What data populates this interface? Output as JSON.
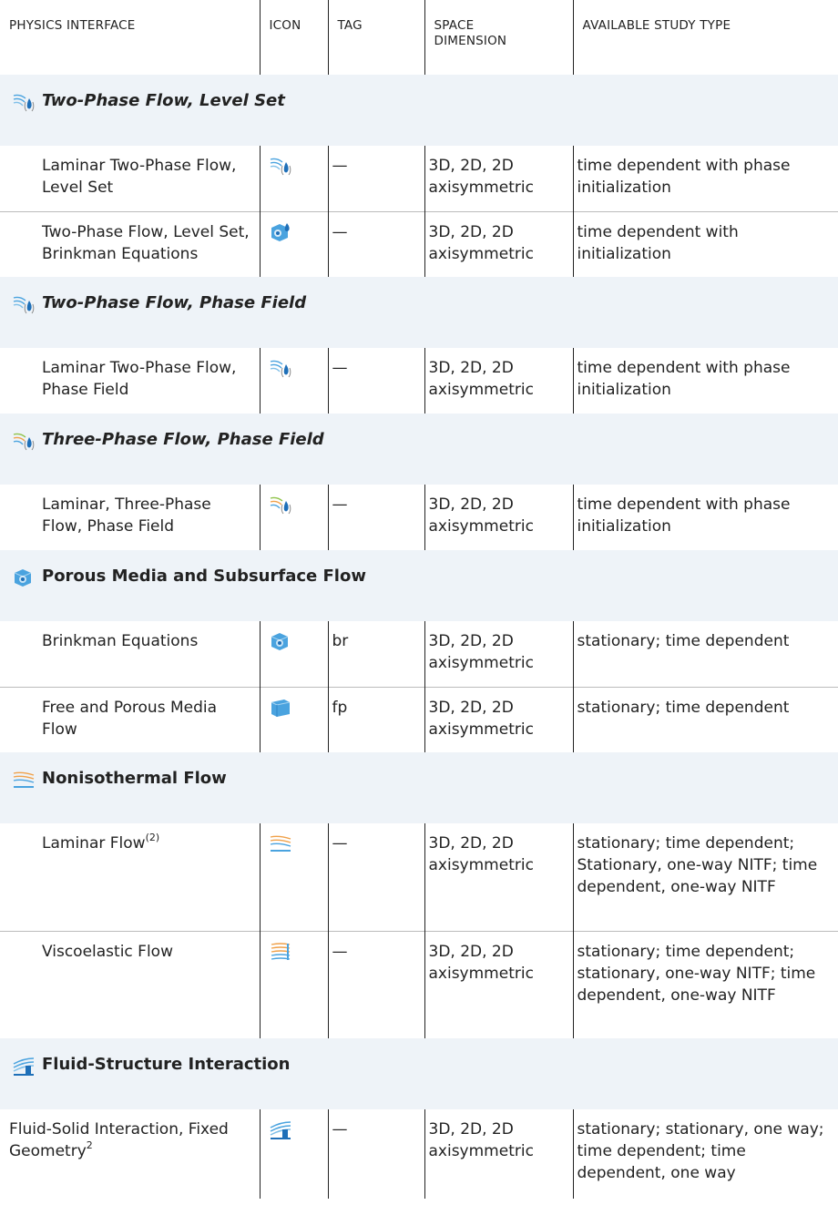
{
  "headers": {
    "physics_interface": "PHYSICS INTERFACE",
    "icon": "ICON",
    "tag": "TAG",
    "space_dimension_1": "SPACE",
    "space_dimension_2": "DIMENSION",
    "available_study_type": "AVAILABLE STUDY TYPE"
  },
  "colors": {
    "section_bg": "#eef3f8",
    "icon_blue": "#4aa3df",
    "icon_green": "#8fc34a",
    "icon_orange": "#f0a14a"
  },
  "sections": {
    "s1": {
      "title": "Two-Phase Flow, Level Set",
      "icon": "two-phase-flow-icon"
    },
    "s2": {
      "title": "Two-Phase Flow, Phase Field",
      "icon": "two-phase-flow-icon"
    },
    "s3": {
      "title": "Three-Phase Flow, Phase Field",
      "icon": "three-phase-flow-icon"
    },
    "s4": {
      "title": "Porous Media and Subsurface Flow",
      "icon": "porous-media-icon"
    },
    "s5": {
      "title": "Nonisothermal Flow",
      "icon": "nonisothermal-flow-icon"
    },
    "s6": {
      "title": "Fluid-Structure Interaction",
      "icon": "fluid-structure-icon"
    }
  },
  "rows": {
    "r1": {
      "name": "Laminar Two-Phase Flow, Level Set",
      "tag": "—",
      "space": "3D, 2D, 2D axisymmetric",
      "study": "time dependent with phase initialization",
      "icon": "two-phase-flow-icon"
    },
    "r2": {
      "name": "Two-Phase Flow, Level Set, Brinkman Equations",
      "tag": "—",
      "space": "3D, 2D, 2D axisymmetric",
      "study": "time dependent with initialization",
      "icon": "brinkman-two-phase-icon"
    },
    "r3": {
      "name": "Laminar Two-Phase Flow, Phase Field",
      "tag": "—",
      "space": "3D, 2D, 2D axisymmetric",
      "study": "time dependent with phase initialization",
      "icon": "two-phase-flow-icon"
    },
    "r4": {
      "name": "Laminar, Three-Phase Flow, Phase Field",
      "tag": "—",
      "space": "3D, 2D, 2D axisymmetric",
      "study": "time dependent with phase initialization",
      "icon": "three-phase-flow-icon"
    },
    "r5": {
      "name": "Brinkman Equations",
      "tag": "br",
      "space": "3D, 2D, 2D axisymmetric",
      "study": "stationary; time dependent",
      "icon": "brinkman-icon"
    },
    "r6": {
      "name": "Free and Porous Media Flow",
      "tag": "fp",
      "space": "3D, 2D, 2D axisymmetric",
      "study": "stationary; time dependent",
      "icon": "free-porous-icon"
    },
    "r7": {
      "name": "Laminar Flow",
      "name_sup": "(2)",
      "tag": "—",
      "space": "3D, 2D, 2D axisymmetric",
      "study": "stationary; time dependent; Stationary, one-way NITF; time dependent, one-way NITF",
      "icon": "laminar-nonisothermal-icon"
    },
    "r8": {
      "name": "Viscoelastic Flow",
      "tag": "—",
      "space": "3D, 2D, 2D axisymmetric",
      "study": "stationary; time dependent; stationary, one-way NITF; time dependent, one-way NITF",
      "icon": "viscoelastic-icon"
    },
    "r9": {
      "name": "Fluid-Solid Interaction, Fixed Geometry",
      "name_sup": "2",
      "tag": "—",
      "space": "3D, 2D, 2D axisymmetric",
      "study": "stationary; stationary, one way; time dependent; time dependent, one way",
      "icon": "fluid-solid-icon"
    }
  }
}
